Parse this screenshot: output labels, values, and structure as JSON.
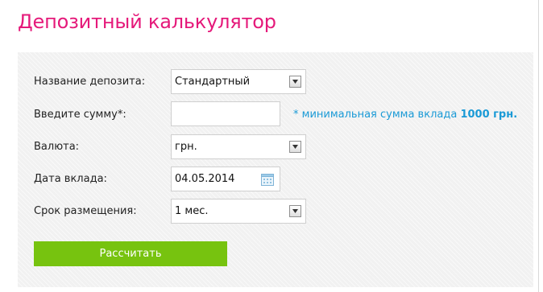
{
  "page": {
    "title": "Депозитный калькулятор"
  },
  "colors": {
    "title": "#e5197a",
    "hint": "#1a9ad6",
    "button": "#77c30f",
    "panel_background": "#f1f1f1"
  },
  "form": {
    "deposit_name": {
      "label": "Название депозита:",
      "value": "Стандартный",
      "icon": "chevron-down-icon"
    },
    "amount": {
      "label": "Введите сумму*:",
      "value": "",
      "hint_prefix": "* минимальная сумма вклада",
      "hint_amount": "1000 грн."
    },
    "currency": {
      "label": "Валюта:",
      "value": "грн.",
      "icon": "chevron-down-icon"
    },
    "deposit_date": {
      "label": "Дата вклада:",
      "value": "04.05.2014",
      "icon": "calendar-icon"
    },
    "term": {
      "label": "Срок размещения:",
      "value": "1 мес.",
      "icon": "chevron-down-icon"
    },
    "submit_label": "Рассчитать"
  }
}
